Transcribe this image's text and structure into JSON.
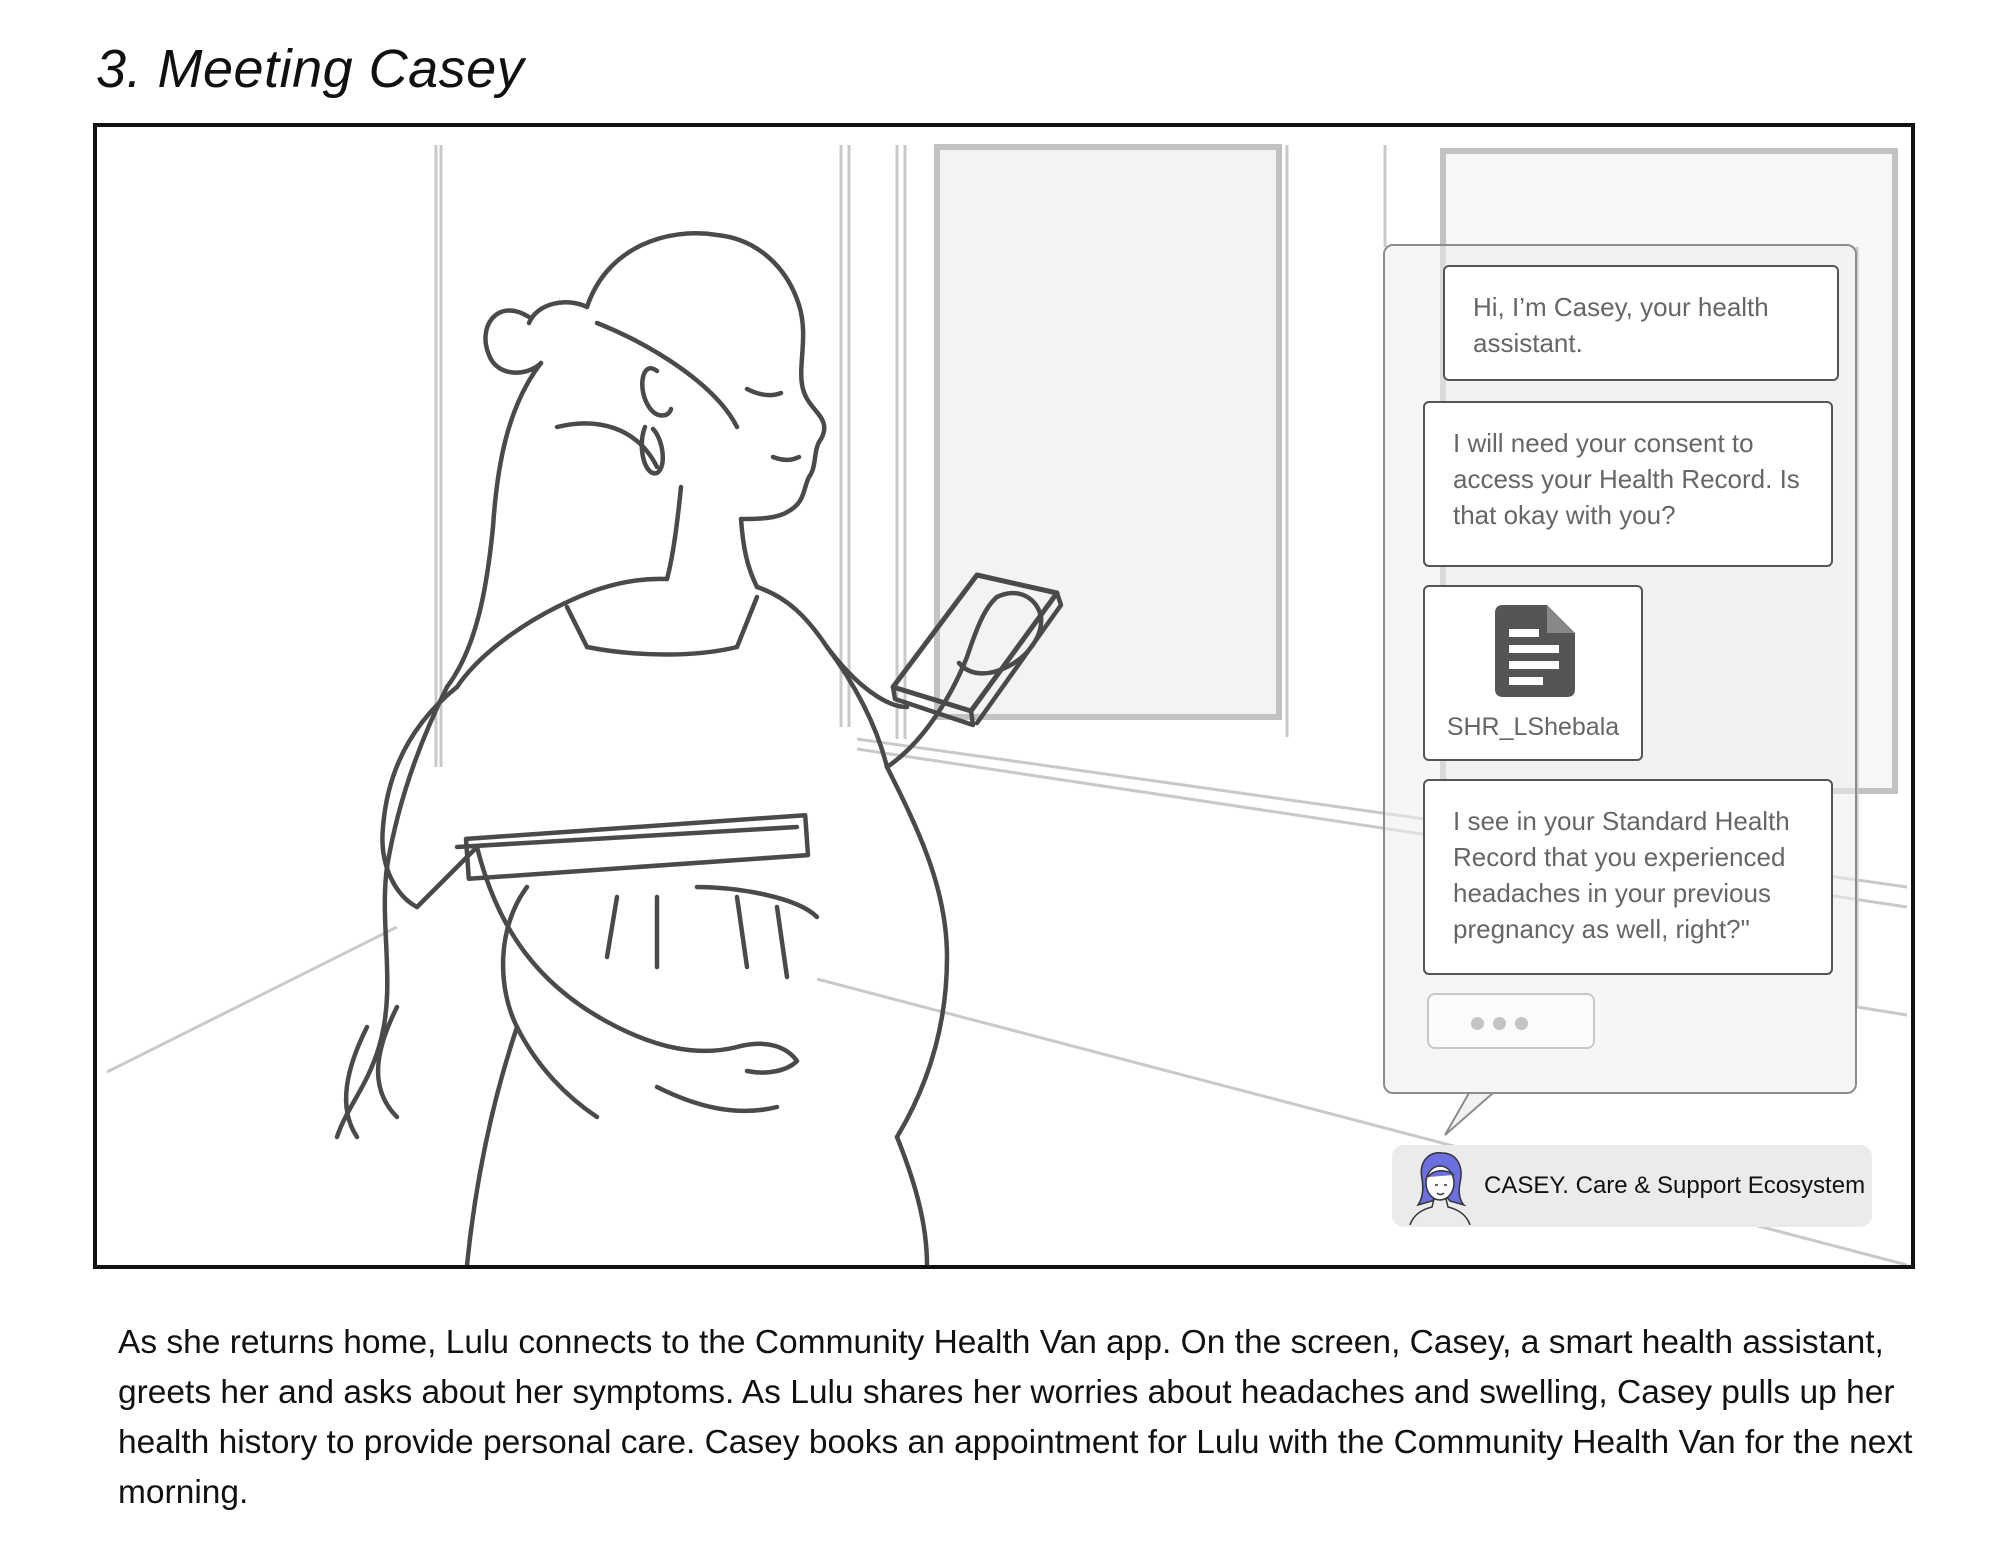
{
  "title": "3. Meeting Casey",
  "chat": {
    "messages": [
      "Hi, I’m Casey, your health assistant.",
      "I will need your consent to access your Health Record. Is that okay with you?",
      "I see in your Standard Health Record that you experienced headaches in your previous pregnancy as well, right?\""
    ],
    "attachment": {
      "file_name": "SHR_LShebala",
      "icon": "document-icon"
    },
    "typing_indicator": "typing-dots-icon"
  },
  "casey_badge": {
    "label": "CASEY. Care & Support Ecosystem",
    "avatar": "casey-avatar-icon",
    "hair_color": "#6b6fe0"
  },
  "caption": "As she returns home, Lulu connects to the Community Health Van app. On the screen, Casey, a smart health assistant, greets her and asks about her symptoms. As Lulu shares her worries about headaches and swelling, Casey pulls up her health history to provide personal care. Casey books an appointment for Lulu with the Community Health Van for the next morning."
}
